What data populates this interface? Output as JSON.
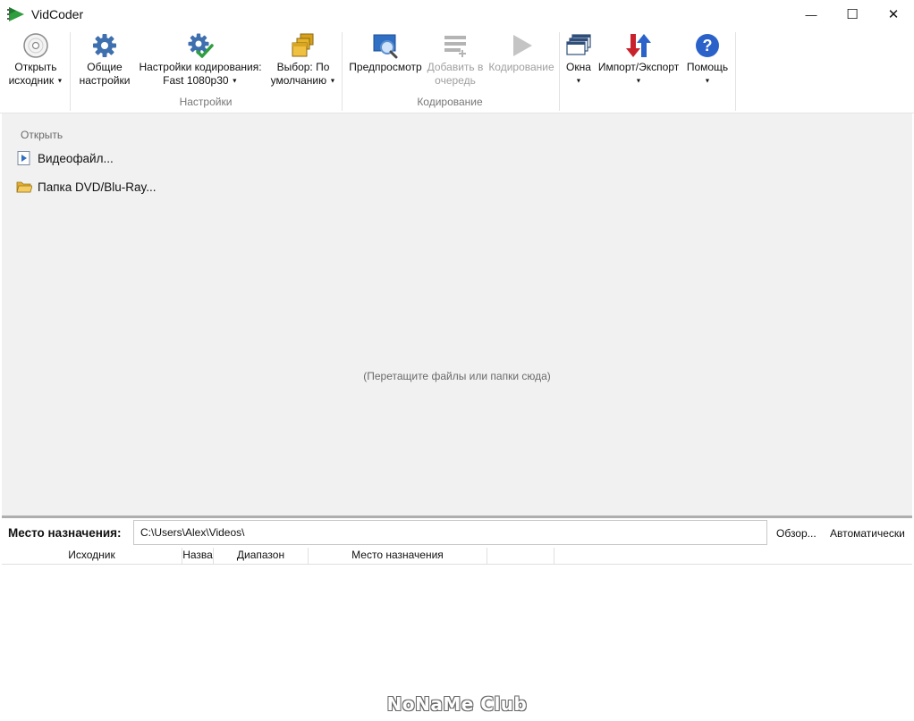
{
  "window": {
    "title": "VidCoder",
    "minimize": "—",
    "maximize": "☐",
    "close": "✕"
  },
  "ribbon": {
    "open_source": {
      "line1": "Открыть",
      "line2": "исходник",
      "icon": "disc-icon"
    },
    "general_settings": {
      "line1": "Общие",
      "line2": "настройки",
      "icon": "gear-icon"
    },
    "encoding_settings": {
      "line1": "Настройки кодирования:",
      "line2": "Fast 1080p30",
      "icon": "gear-check-icon"
    },
    "pick_default": {
      "line1": "Выбор: По",
      "line2": "умолчанию",
      "icon": "folders-icon"
    },
    "preview": {
      "line1": "Предпросмотр",
      "line2": "",
      "icon": "preview-icon"
    },
    "add_to_queue": {
      "line1": "Добавить в",
      "line2": "очередь",
      "icon": "queue-add-icon"
    },
    "encode": {
      "line1": "Кодирование",
      "line2": "",
      "icon": "play-icon"
    },
    "windows": {
      "line1": "Окна",
      "icon": "windows-icon"
    },
    "import_export": {
      "line1": "Импорт/Экспорт",
      "icon": "import-export-icon"
    },
    "help": {
      "line1": "Помощь",
      "icon": "help-icon"
    },
    "groups": {
      "settings": "Настройки",
      "encoding": "Кодирование"
    }
  },
  "main": {
    "open_label": "Открыть",
    "video_file": "Видеофайл...",
    "dvd_folder": "Папка DVD/Blu-Ray...",
    "drop_hint": "(Перетащите файлы или папки сюда)"
  },
  "destination": {
    "label": "Место назначения:",
    "path": "C:\\Users\\Alex\\Videos\\",
    "browse": "Обзор...",
    "auto": "Автоматически"
  },
  "queue": {
    "columns": [
      "Исходник",
      "Назва",
      "Диапазон",
      "Место назначения",
      ""
    ]
  },
  "watermark": "NoNaMe Club",
  "colors": {
    "accent_green": "#2e9e3e",
    "disabled_text": "#a0a0a0",
    "help_blue": "#2a62c9"
  }
}
